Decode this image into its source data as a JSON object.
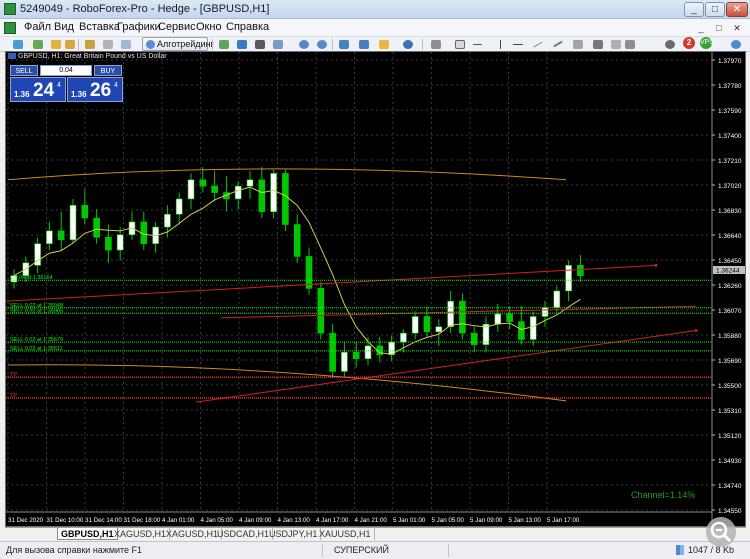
{
  "window": {
    "title": "5249049 - RoboForex-Pro - Hedge - [GBPUSD,H1]",
    "minimize": "_",
    "maximize": "□",
    "close": "✕"
  },
  "menu": {
    "items": [
      "Файл",
      "Вид",
      "Вставка",
      "Графики",
      "Сервис",
      "Окно",
      "Справка"
    ],
    "mdi_buttons": [
      "_",
      "□",
      "✕"
    ]
  },
  "toolbar": {
    "algo_label": "Алготрейдинг",
    "notifications_count": "2",
    "vps_label": "VPS",
    "icons": [
      "new-chart-icon",
      "profiles-icon",
      "market-watch-icon",
      "navigator-icon",
      "terminal-icon",
      "strategy-tester-icon",
      "bar-chart-icon",
      "candle-chart-icon",
      "line-chart-icon",
      "zoom-in-icon",
      "zoom-out-icon",
      "tile-icon",
      "autoscroll-icon",
      "chart-shift-icon",
      "indicators-icon",
      "periods-icon",
      "templates-icon",
      "cursor-icon",
      "crosshair-icon",
      "vertical-line-icon",
      "horizontal-line-icon",
      "trendline-icon",
      "equidistant-channel-icon",
      "fibo-icon",
      "text-icon",
      "text-label-icon",
      "arrows-icon"
    ],
    "colors": {
      "algo_icon": "#5b8fd1",
      "red_badge": "#d23a2f",
      "green_badge": "#3ca13c"
    }
  },
  "chart": {
    "symbol_header": "GBPUSD, H1:  Great Britain Pound vs US Dollar",
    "one_click": {
      "sell_label": "SELL",
      "buy_label": "BUY",
      "volume": "0.04",
      "bid_prefix": "1.36",
      "bid_big": "24",
      "bid_sup": "4",
      "ask_prefix": "1.36",
      "ask_big": "26",
      "ask_sup": "4"
    },
    "current_price_label": "1.36244",
    "channel_label": "Channel=1.14%",
    "order_labels": [
      {
        "text": "L 0.04 at 1.36164",
        "price": 1.36164,
        "color": "#00ff00"
      },
      {
        "text": "SELL 0.02 at 1.35948",
        "price": 1.35948,
        "color": "#00ff00"
      },
      {
        "text": "SELL 0.02 at 1.35905",
        "price": 1.35905,
        "color": "#00ff00"
      },
      {
        "text": "SELL 0.02 at 1.35679",
        "price": 1.35679,
        "color": "#00ff00"
      },
      {
        "text": "SELL 0.02 at 1.35611",
        "price": 1.35611,
        "color": "#00ff00"
      },
      {
        "text": "TP",
        "price": 1.35405,
        "color": "#ff3030"
      },
      {
        "text": "TP",
        "price": 1.35243,
        "color": "#ff3030"
      }
    ],
    "colors": {
      "background": "#000000",
      "grid": "#3a3a3a",
      "bull": "#ffffff",
      "bear": "#00c800",
      "ma_fast": "#d4c850",
      "ma_slow": "#d08a1a",
      "channel": "#d02020",
      "orders": "#00ff00",
      "tp": "#ff3030",
      "axis_text": "#ffffff",
      "price_tag_bg": "#c0c0c0"
    }
  },
  "chart_data": {
    "type": "candlestick",
    "title": "GBPUSD, H1: Great Britain Pound vs US Dollar",
    "ylim": [
      1.3435,
      1.3795
    ],
    "y_ticks": [
      "1.37970",
      "1.37780",
      "1.37590",
      "1.37400",
      "1.37210",
      "1.37020",
      "1.36830",
      "1.36640",
      "1.36450",
      "1.36260",
      "1.36070",
      "1.35880",
      "1.35690",
      "1.35500",
      "1.35310",
      "1.35120",
      "1.34930",
      "1.34740",
      "1.34550"
    ],
    "x_ticks": [
      "31 Dec 2020",
      "31 Dec 10:00",
      "31 Dec 14:00",
      "31 Dec 18:00",
      "4 Jan 01:00",
      "4 Jan 05:00",
      "4 Jan 09:00",
      "4 Jan 13:00",
      "4 Jan 17:00",
      "4 Jan 21:00",
      "5 Jan 01:00",
      "5 Jan 05:00",
      "5 Jan 09:00",
      "5 Jan 13:00",
      "5 Jan 17:00"
    ],
    "ohlc": [
      [
        1.3615,
        1.3625,
        1.361,
        1.362
      ],
      [
        1.362,
        1.3635,
        1.3615,
        1.363
      ],
      [
        1.3628,
        1.365,
        1.3622,
        1.3645
      ],
      [
        1.3645,
        1.3662,
        1.364,
        1.3655
      ],
      [
        1.3655,
        1.367,
        1.364,
        1.3648
      ],
      [
        1.3648,
        1.368,
        1.3645,
        1.3675
      ],
      [
        1.3675,
        1.3688,
        1.366,
        1.3665
      ],
      [
        1.3665,
        1.3672,
        1.3645,
        1.365
      ],
      [
        1.365,
        1.366,
        1.363,
        1.364
      ],
      [
        1.364,
        1.3658,
        1.3632,
        1.3652
      ],
      [
        1.3652,
        1.367,
        1.3648,
        1.3662
      ],
      [
        1.3662,
        1.367,
        1.364,
        1.3645
      ],
      [
        1.3645,
        1.3662,
        1.3638,
        1.3658
      ],
      [
        1.3658,
        1.3675,
        1.365,
        1.3668
      ],
      [
        1.3668,
        1.3685,
        1.366,
        1.368
      ],
      [
        1.368,
        1.37,
        1.3672,
        1.3695
      ],
      [
        1.3695,
        1.3705,
        1.3685,
        1.369
      ],
      [
        1.369,
        1.3702,
        1.3678,
        1.3685
      ],
      [
        1.3685,
        1.3698,
        1.367,
        1.368
      ],
      [
        1.368,
        1.3694,
        1.3672,
        1.369
      ],
      [
        1.369,
        1.3702,
        1.368,
        1.3695
      ],
      [
        1.3695,
        1.3705,
        1.3665,
        1.367
      ],
      [
        1.367,
        1.3703,
        1.3665,
        1.37
      ],
      [
        1.37,
        1.3703,
        1.3655,
        1.366
      ],
      [
        1.366,
        1.3668,
        1.363,
        1.3635
      ],
      [
        1.3635,
        1.3642,
        1.3605,
        1.361
      ],
      [
        1.361,
        1.3615,
        1.357,
        1.3575
      ],
      [
        1.3575,
        1.3582,
        1.354,
        1.3545
      ],
      [
        1.3545,
        1.3568,
        1.354,
        1.356
      ],
      [
        1.356,
        1.3568,
        1.3548,
        1.3555
      ],
      [
        1.3555,
        1.3572,
        1.355,
        1.3565
      ],
      [
        1.3565,
        1.3572,
        1.3552,
        1.3558
      ],
      [
        1.3558,
        1.3573,
        1.3553,
        1.3568
      ],
      [
        1.3568,
        1.3578,
        1.356,
        1.3575
      ],
      [
        1.3575,
        1.3592,
        1.357,
        1.3588
      ],
      [
        1.3588,
        1.3596,
        1.3572,
        1.3576
      ],
      [
        1.3576,
        1.3586,
        1.3565,
        1.358
      ],
      [
        1.358,
        1.3608,
        1.3575,
        1.36
      ],
      [
        1.36,
        1.3606,
        1.357,
        1.3575
      ],
      [
        1.3575,
        1.358,
        1.356,
        1.3566
      ],
      [
        1.3566,
        1.3588,
        1.356,
        1.3582
      ],
      [
        1.3582,
        1.3598,
        1.3576,
        1.359
      ],
      [
        1.359,
        1.3596,
        1.3578,
        1.3584
      ],
      [
        1.3584,
        1.3596,
        1.3566,
        1.357
      ],
      [
        1.357,
        1.3592,
        1.3565,
        1.3588
      ],
      [
        1.3588,
        1.36,
        1.358,
        1.3595
      ],
      [
        1.3595,
        1.3612,
        1.359,
        1.3608
      ],
      [
        1.3608,
        1.3632,
        1.36,
        1.3628
      ],
      [
        1.3628,
        1.3636,
        1.3615,
        1.362
      ]
    ],
    "indicators": [
      "moving-average-fast",
      "moving-average-slow",
      "envelope-upper",
      "envelope-lower",
      "regression-channel"
    ]
  },
  "tabs": {
    "items": [
      "GBPUSD,H1",
      "XAGUSD,H1",
      "XAGUSD,H1",
      "USDCAD,H1",
      "USDJPY,H1",
      "XAUUSD,H1"
    ],
    "active_index": 0
  },
  "status": {
    "help_text": "Для вызова справки нажмите F1",
    "profile": "СУПЕРСКИЙ",
    "traffic": "1047 / 8 Kb"
  }
}
